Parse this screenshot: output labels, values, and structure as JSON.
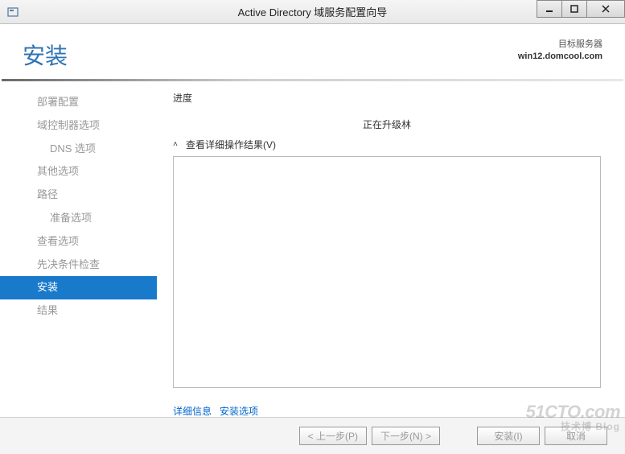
{
  "titlebar": {
    "title": "Active Directory 域服务配置向导"
  },
  "header": {
    "page_title": "安装",
    "target_label": "目标服务器",
    "target_value": "win12.domcool.com"
  },
  "sidebar": {
    "items": [
      {
        "label": "部署配置",
        "indent": false,
        "selected": false
      },
      {
        "label": "域控制器选项",
        "indent": false,
        "selected": false
      },
      {
        "label": "DNS 选项",
        "indent": true,
        "selected": false
      },
      {
        "label": "其他选项",
        "indent": false,
        "selected": false
      },
      {
        "label": "路径",
        "indent": false,
        "selected": false
      },
      {
        "label": "准备选项",
        "indent": true,
        "selected": false
      },
      {
        "label": "查看选项",
        "indent": false,
        "selected": false
      },
      {
        "label": "先决条件检查",
        "indent": false,
        "selected": false
      },
      {
        "label": "安装",
        "indent": false,
        "selected": true
      },
      {
        "label": "结果",
        "indent": false,
        "selected": false
      }
    ]
  },
  "main": {
    "progress_label": "进度",
    "status_text": "正在升级林",
    "expander_label": "查看详细操作结果(V)",
    "links": {
      "details": "详细信息",
      "options": "安装选项"
    }
  },
  "footer": {
    "prev": "< 上一步(P)",
    "next": "下一步(N) >",
    "install": "安装(I)",
    "cancel": "取消"
  },
  "watermark": {
    "main": "51CTO.com",
    "sub": "技术博 Blog"
  }
}
